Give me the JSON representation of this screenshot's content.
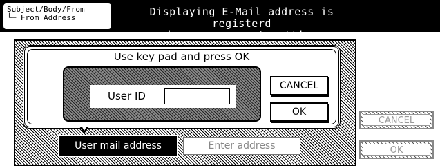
{
  "header": {
    "tab_line1": "Subject/Body/From",
    "tab_line2": "└─ From Address",
    "message_line1": "Displaying E-Mail address is registerd",
    "message_line2": "in user account setting"
  },
  "dialog": {
    "instruction": "Use key pad and press OK",
    "userid_label": "User ID",
    "userid_value": "",
    "cancel_label": "CANCEL",
    "ok_label": "OK"
  },
  "address_row": {
    "mail_button_label": "User mail address",
    "enter_placeholder": "Enter address"
  },
  "side_buttons": {
    "cancel_label": "CANCEL",
    "ok_label": "OK"
  }
}
